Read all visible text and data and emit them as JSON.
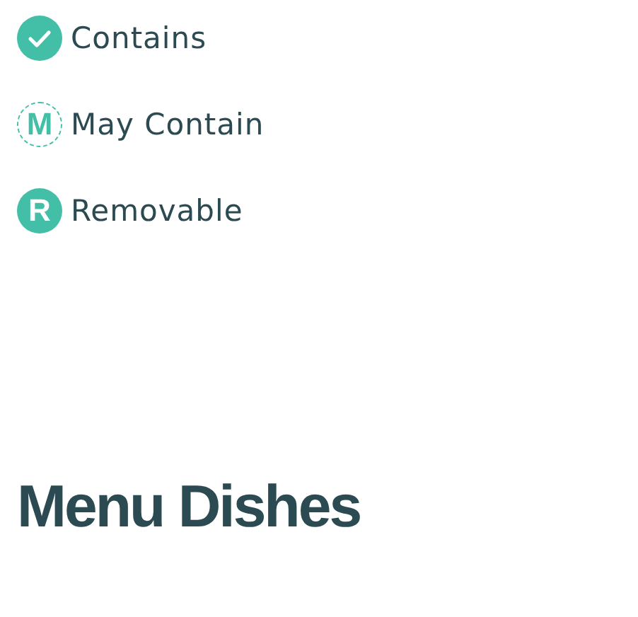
{
  "legend": [
    {
      "kind": "check",
      "label": "Contains"
    },
    {
      "kind": "dashed-letter",
      "letter": "M",
      "label": "May Contain"
    },
    {
      "kind": "letter",
      "letter": "R",
      "label": "Removable"
    }
  ],
  "heading": "Menu Dishes"
}
